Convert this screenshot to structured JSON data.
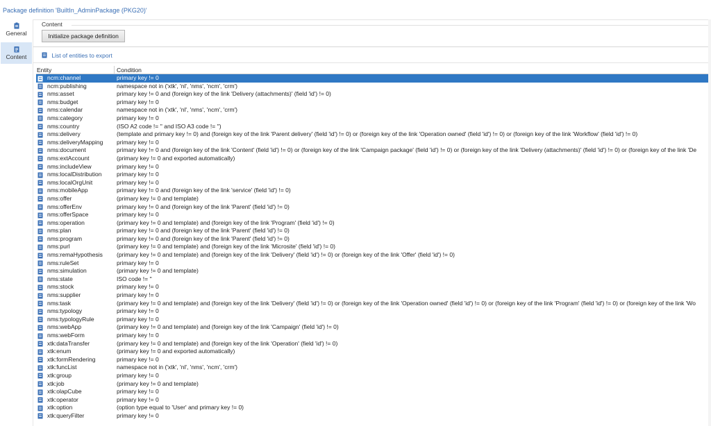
{
  "window": {
    "title": "Package definition 'BuiltIn_AdminPackage (PKG20)'"
  },
  "sidebar": {
    "items": [
      {
        "label": "General",
        "icon": "clipboard-icon"
      },
      {
        "label": "Content",
        "icon": "document-icon",
        "active": true
      }
    ]
  },
  "content": {
    "section_label": "Content",
    "init_button": "Initialize package definition",
    "list_link": "List of entities to export"
  },
  "grid": {
    "headers": {
      "entity": "Entity",
      "condition": "Condition"
    },
    "rows": [
      {
        "entity": "ncm:channel",
        "condition": "primary key != 0",
        "selected": true
      },
      {
        "entity": "ncm:publishing",
        "condition": "namespace not in ('xtk', 'nl', 'nms', 'ncm', 'crm')"
      },
      {
        "entity": "nms:asset",
        "condition": "primary key != 0 and (foreign key of the link 'Delivery (attachments)' (field 'id') != 0)"
      },
      {
        "entity": "nms:budget",
        "condition": "primary key != 0"
      },
      {
        "entity": "nms:calendar",
        "condition": "namespace not in ('xtk', 'nl', 'nms', 'ncm', 'crm')"
      },
      {
        "entity": "nms:category",
        "condition": "primary key != 0"
      },
      {
        "entity": "nms:country",
        "condition": "(ISO A2 code != '' and ISO A3 code != '')"
      },
      {
        "entity": "nms:delivery",
        "condition": "(template and primary key != 0) and (foreign key of the link 'Parent delivery' (field 'id') != 0) or (foreign key of the link 'Operation owned' (field 'id') != 0) or (foreign key of the link 'Workflow' (field 'id') != 0)"
      },
      {
        "entity": "nms:deliveryMapping",
        "condition": "primary key != 0"
      },
      {
        "entity": "nms:document",
        "condition": "primary key != 0 and (foreign key of the link 'Content' (field 'id') != 0) or (foreign key of the link 'Campaign package' (field 'id') != 0) or (foreign key of the link 'Delivery (attachments)' (field 'id') != 0) or (foreign key of the link 'De"
      },
      {
        "entity": "nms:extAccount",
        "condition": "(primary key != 0 and exported automatically)"
      },
      {
        "entity": "nms:includeView",
        "condition": "primary key != 0"
      },
      {
        "entity": "nms:localDistribution",
        "condition": "primary key != 0"
      },
      {
        "entity": "nms:localOrgUnit",
        "condition": "primary key != 0"
      },
      {
        "entity": "nms:mobileApp",
        "condition": "primary key != 0 and (foreign key of the link 'service' (field 'id') != 0)"
      },
      {
        "entity": "nms:offer",
        "condition": "(primary key != 0 and template)"
      },
      {
        "entity": "nms:offerEnv",
        "condition": "primary key != 0 and (foreign key of the link 'Parent' (field 'id') != 0)"
      },
      {
        "entity": "nms:offerSpace",
        "condition": "primary key != 0"
      },
      {
        "entity": "nms:operation",
        "condition": "(primary key != 0 and template) and (foreign key of the link 'Program' (field 'id') != 0)"
      },
      {
        "entity": "nms:plan",
        "condition": "primary key != 0 and (foreign key of the link 'Parent' (field 'id') != 0)"
      },
      {
        "entity": "nms:program",
        "condition": "primary key != 0 and (foreign key of the link 'Parent' (field 'id') != 0)"
      },
      {
        "entity": "nms:purl",
        "condition": "(primary key != 0 and template) and (foreign key of the link 'Microsite' (field 'id') != 0)"
      },
      {
        "entity": "nms:remaHypothesis",
        "condition": "(primary key != 0 and template) and (foreign key of the link 'Delivery' (field 'id') != 0) or (foreign key of the link 'Offer' (field 'id') != 0)"
      },
      {
        "entity": "nms:ruleSet",
        "condition": "primary key != 0"
      },
      {
        "entity": "nms:simulation",
        "condition": "(primary key != 0 and template)"
      },
      {
        "entity": "nms:state",
        "condition": "ISO code != ''"
      },
      {
        "entity": "nms:stock",
        "condition": "primary key != 0"
      },
      {
        "entity": "nms:supplier",
        "condition": "primary key != 0"
      },
      {
        "entity": "nms:task",
        "condition": "(primary key != 0 and template) and (foreign key of the link 'Delivery' (field 'id') != 0) or (foreign key of the link 'Operation owned' (field 'id') != 0) or (foreign key of the link 'Program' (field 'id') != 0) or (foreign key of the link 'Wo"
      },
      {
        "entity": "nms:typology",
        "condition": "primary key != 0"
      },
      {
        "entity": "nms:typologyRule",
        "condition": "primary key != 0"
      },
      {
        "entity": "nms:webApp",
        "condition": "(primary key != 0 and template) and (foreign key of the link 'Campaign' (field 'id') != 0)"
      },
      {
        "entity": "nms:webForm",
        "condition": "primary key != 0"
      },
      {
        "entity": "xtk:dataTransfer",
        "condition": "(primary key != 0 and template) and (foreign key of the link 'Operation' (field 'id') != 0)"
      },
      {
        "entity": "xtk:enum",
        "condition": "(primary key != 0 and exported automatically)"
      },
      {
        "entity": "xtk:formRendering",
        "condition": "primary key != 0"
      },
      {
        "entity": "xtk:funcList",
        "condition": "namespace not in ('xtk', 'nl', 'nms', 'ncm', 'crm')"
      },
      {
        "entity": "xtk:group",
        "condition": "primary key != 0"
      },
      {
        "entity": "xtk:job",
        "condition": "(primary key != 0 and template)"
      },
      {
        "entity": "xtk:olapCube",
        "condition": "primary key != 0"
      },
      {
        "entity": "xtk:operator",
        "condition": "primary key != 0"
      },
      {
        "entity": "xtk:option",
        "condition": "(option type equal to 'User' and primary key != 0)"
      },
      {
        "entity": "xtk:queryFilter",
        "condition": "primary key != 0"
      }
    ]
  },
  "colors": {
    "accent": "#2f78c4",
    "link": "#3a6fb5",
    "sidebar_active": "#d8e6f6"
  }
}
